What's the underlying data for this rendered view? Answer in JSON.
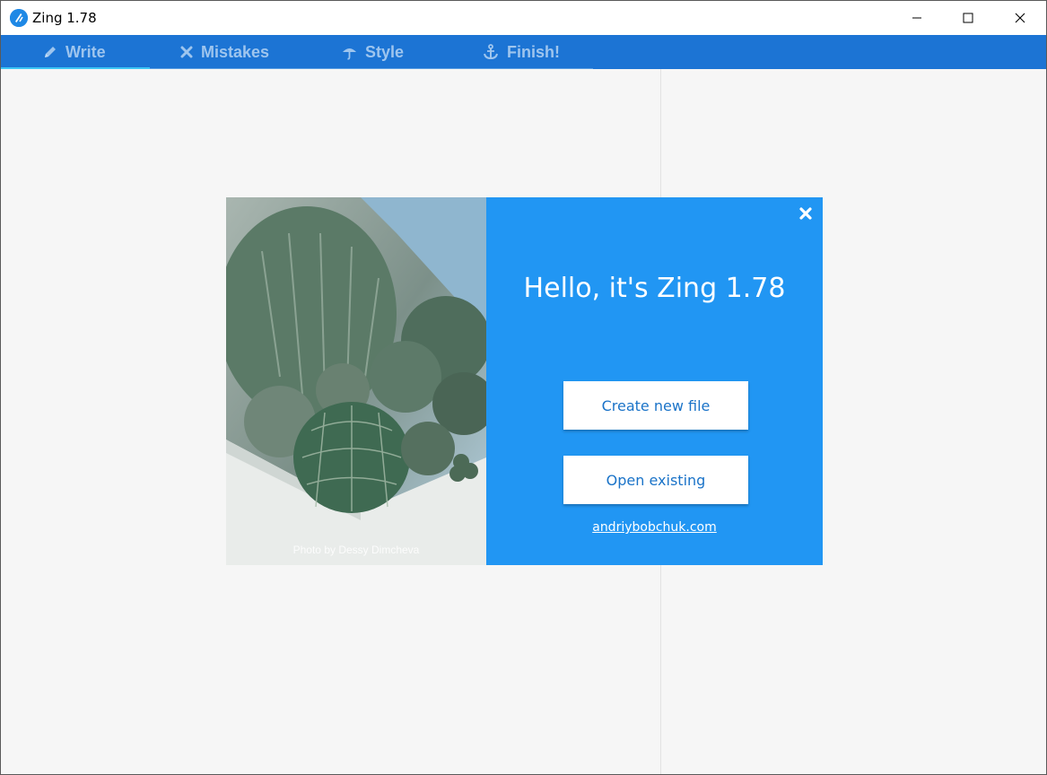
{
  "window": {
    "title": "Zing 1.78"
  },
  "tabs": [
    {
      "label": "Write",
      "icon": "pencil-icon"
    },
    {
      "label": "Mistakes",
      "icon": "x-icon"
    },
    {
      "label": "Style",
      "icon": "umbrella-icon"
    },
    {
      "label": "Finish!",
      "icon": "anchor-icon"
    }
  ],
  "active_tab": "Write",
  "dialog": {
    "heading": "Hello, it's Zing 1.78",
    "create_label": "Create new file",
    "open_label": "Open existing",
    "link_text": "andriybobchuk.com",
    "photo_credit": "Photo by Dessy Dimcheva"
  },
  "colors": {
    "tabbar": "#1c74d4",
    "tab_text": "#9ec5ee",
    "active_underline": "#3ec6f5",
    "dialog_panel": "#2196f3",
    "button_text": "#1a73c8",
    "editor_bg": "#f6f6f6"
  }
}
